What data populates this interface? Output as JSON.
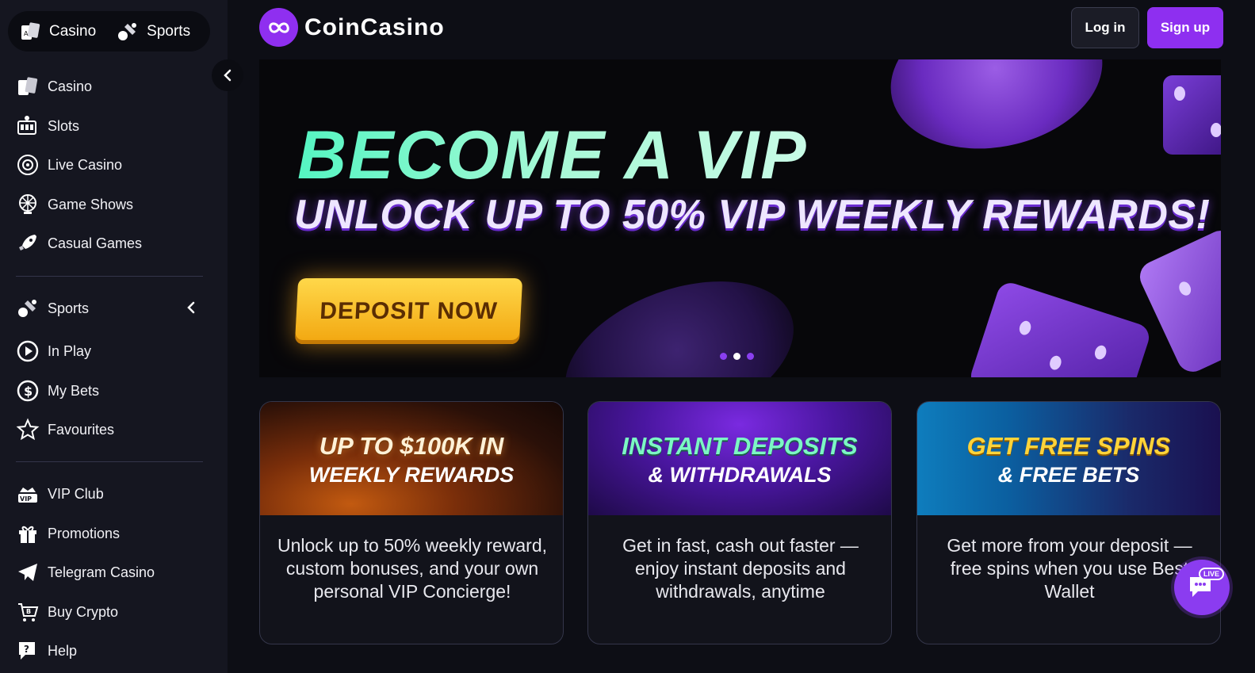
{
  "mode_switch": {
    "casino": "Casino",
    "sports": "Sports"
  },
  "sidebar": {
    "casino_items": [
      "Casino",
      "Slots",
      "Live Casino",
      "Game Shows",
      "Casual Games"
    ],
    "sports_items": [
      "Sports",
      "In Play",
      "My Bets",
      "Favourites"
    ],
    "misc_items": [
      "VIP Club",
      "Promotions",
      "Telegram Casino",
      "Buy Crypto",
      "Help"
    ]
  },
  "header": {
    "brand": "CoinCasino",
    "login": "Log in",
    "signup": "Sign up"
  },
  "hero": {
    "title": "BECOME A VIP",
    "subtitle": "UNLOCK UP TO 50% VIP WEEKLY REWARDS!",
    "cta": "DEPOSIT NOW",
    "slides": 3,
    "active_slide": 2
  },
  "cards": [
    {
      "title1": "UP TO $100K IN",
      "title2": "WEEKLY REWARDS",
      "desc": "Unlock up to 50% weekly reward, custom bonuses, and your own personal VIP Concierge!"
    },
    {
      "title1": "INSTANT DEPOSITS",
      "title2": "& WITHDRAWALS",
      "desc": "Get in fast, cash out faster — enjoy instant deposits and withdrawals, anytime"
    },
    {
      "title1": "GET FREE SPINS",
      "title2": "& FREE BETS",
      "desc": "Get more from your deposit — free spins when you use Best Wallet"
    }
  ],
  "chat": {
    "badge": "LIVE"
  },
  "colors": {
    "accent": "#8e2ff0",
    "background": "#0d0e15",
    "sidebar": "#151620",
    "cta": "#f2a60f"
  }
}
